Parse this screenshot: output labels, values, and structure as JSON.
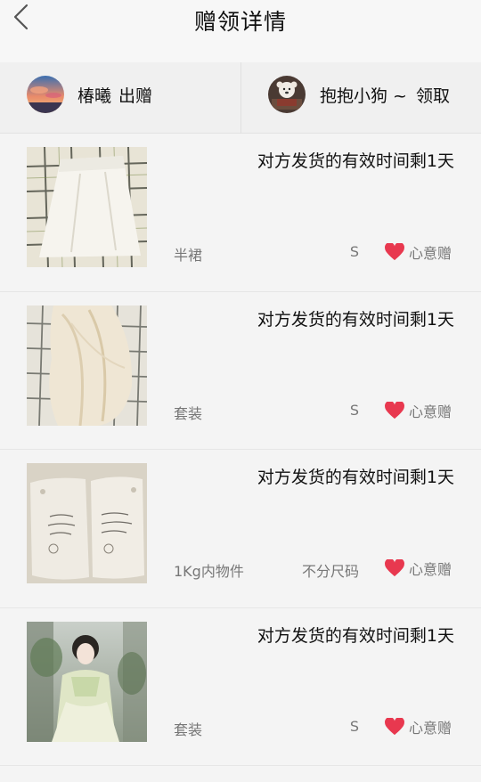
{
  "header": {
    "title": "赠领详情"
  },
  "parties": {
    "giver": {
      "name": "椿曦",
      "action": "出赠"
    },
    "receiver": {
      "name": "抱抱小狗 ~",
      "action": "领取"
    }
  },
  "colors": {
    "heart": "#e8384f",
    "muted_text": "#777777"
  },
  "items": [
    {
      "image": "white-skirt-photo",
      "deadline": "对方发货的有效时间剩1天",
      "category": "半裙",
      "size": "S",
      "gift_label": "心意赠"
    },
    {
      "image": "cream-outfit-photo",
      "deadline": "对方发货的有效时间剩1天",
      "category": "套装",
      "size": "S",
      "gift_label": "心意赠"
    },
    {
      "image": "cotton-underwear-packs-photo",
      "deadline": "对方发货的有效时间剩1天",
      "category": "1Kg内物件",
      "size": "不分尺码",
      "gift_label": "心意赠"
    },
    {
      "image": "hanfu-model-photo",
      "deadline": "对方发货的有效时间剩1天",
      "category": "套装",
      "size": "S",
      "gift_label": "心意赠"
    }
  ]
}
